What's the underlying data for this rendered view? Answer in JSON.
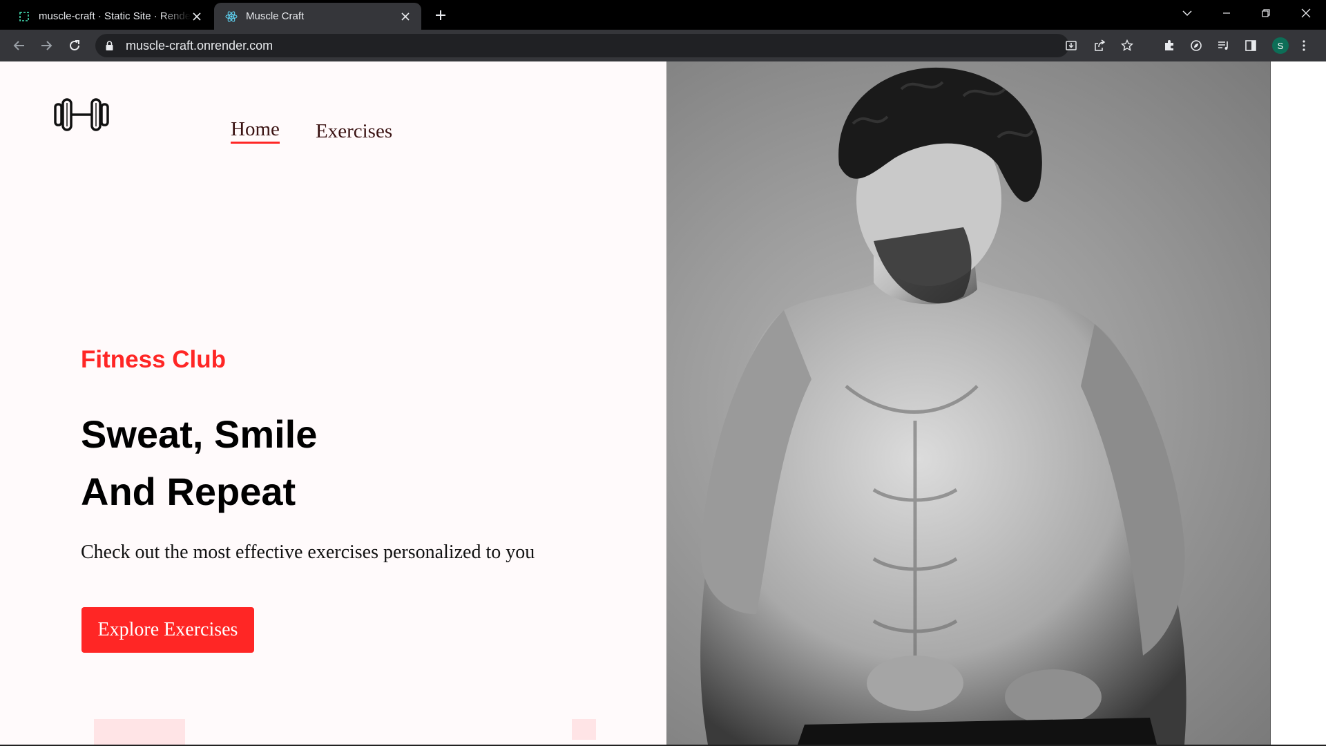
{
  "browser": {
    "tabs": [
      {
        "title": "muscle-craft · Static Site · Render",
        "favicon": "render-icon",
        "active": false
      },
      {
        "title": "Muscle Craft",
        "favicon": "react-icon",
        "active": true
      }
    ],
    "url": "muscle-craft.onrender.com",
    "profile_initial": "S",
    "colors": {
      "tabbar": "#000000",
      "toolbar": "#35363a",
      "omnibox": "#202124",
      "profile": "#0d6e57"
    }
  },
  "site": {
    "logo_icon": "dumbbell-icon",
    "nav": {
      "home": "Home",
      "exercises": "Exercises"
    },
    "hero": {
      "tagline": "Fitness Club",
      "headline_line1": "Sweat, Smile",
      "headline_line2": "And Repeat",
      "subtext": "Check out the most effective exercises personalized to you",
      "cta": "Explore Exercises"
    },
    "colors": {
      "accent": "#ff2625",
      "background": "#fffafb",
      "nav_text": "#3a1212",
      "decor": "#ffe4e6"
    }
  }
}
